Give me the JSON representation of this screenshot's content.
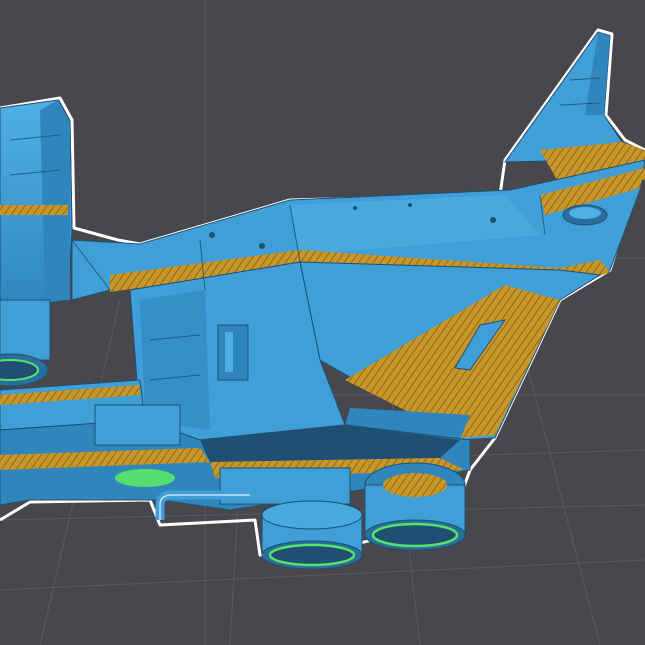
{
  "viewport": {
    "kind": "3d-slicer-preview",
    "subject": "spaceship-model",
    "colors": {
      "background": "#48484c",
      "grid": "#5a5a5f",
      "model_surface": "#3f9fd6",
      "model_shadow": "#2a6f9c",
      "model_dark": "#1f4f72",
      "overhang_highlight": "#c9962a",
      "overhang_dark": "#8a6a1e",
      "outline": "#ffffff",
      "selection_ring": "#56e36a"
    }
  }
}
